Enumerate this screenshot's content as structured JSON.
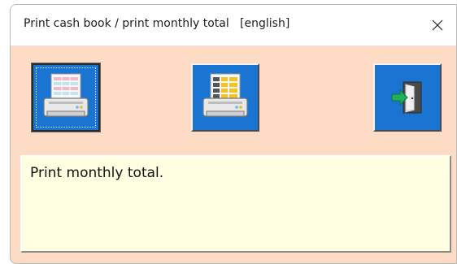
{
  "window": {
    "title": "Print cash book / print monthly total   [english]"
  },
  "toolbar": {
    "buttons": [
      {
        "name": "print-cash-book",
        "icon": "printer-cash-book-icon",
        "state": "pressed"
      },
      {
        "name": "print-monthly-total",
        "icon": "printer-monthly-total-icon"
      },
      {
        "name": "exit",
        "icon": "exit-door-icon"
      }
    ]
  },
  "message": {
    "text": "Print monthly total."
  },
  "colors": {
    "window_bg": "#fddbc4",
    "button_bg": "#1a74d2",
    "message_bg": "#ffffe1"
  }
}
